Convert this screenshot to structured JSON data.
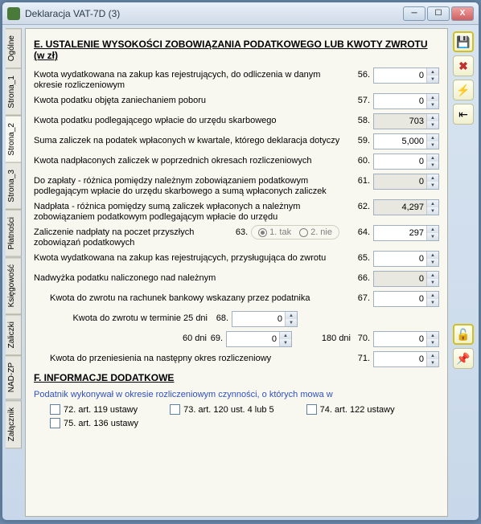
{
  "window": {
    "title": "Deklaracja VAT-7D (3)"
  },
  "tabs": [
    "Ogólne",
    "Strona_1",
    "Strona_2",
    "Strona_3",
    "Płatności",
    "Księgowość",
    "Zaliczki",
    "NAD-ZP",
    "Załącznik"
  ],
  "active_tab_index": 2,
  "section_e": {
    "header": "E. USTALENIE WYSOKOŚCI ZOBOWIĄZANIA PODATKOWEGO LUB KWOTY ZWROTU (w zł)",
    "rows": [
      {
        "label": "Kwota wydatkowana na zakup kas rejestrujących, do odliczenia w danym okresie rozliczeniowym",
        "num": "56.",
        "val": "0",
        "ro": false
      },
      {
        "label": "Kwota podatku objęta zaniechaniem poboru",
        "num": "57.",
        "val": "0",
        "ro": false
      },
      {
        "label": "Kwota podatku podlegającego wpłacie do urzędu skarbowego",
        "num": "58.",
        "val": "703",
        "ro": true
      },
      {
        "label": "Suma zaliczek na podatek wpłaconych w kwartale, którego deklaracja dotyczy",
        "num": "59.",
        "val": "5,000",
        "ro": false
      },
      {
        "label": "Kwota nadpłaconych zaliczek w poprzednich okresach rozliczeniowych",
        "num": "60.",
        "val": "0",
        "ro": false
      },
      {
        "label": "Do zapłaty - różnica pomiędzy należnym zobowiązaniem podatkowym podlegającym wpłacie do urzędu skarbowego a sumą wpłaconych zaliczek",
        "num": "61.",
        "val": "0",
        "ro": true
      },
      {
        "label": "Nadpłata - różnica pomiędzy sumą zaliczek wpłaconych a należnym zobowiązaniem podatkowym podlegającym wpłacie do urzędu",
        "num": "62.",
        "val": "4,297",
        "ro": true
      }
    ],
    "row63": {
      "label": "Zaliczenie nadpłaty na poczet przyszłych zobowiązań podatkowych",
      "num": "63.",
      "opt1": "1. tak",
      "opt2": "2. nie",
      "num64": "64.",
      "val64": "297"
    },
    "rows2": [
      {
        "label": "Kwota wydatkowana na zakup kas rejestrujących, przysługująca do zwrotu",
        "num": "65.",
        "val": "0",
        "ro": false
      },
      {
        "label": "Nadwyżka podatku naliczonego nad należnym",
        "num": "66.",
        "val": "0",
        "ro": true
      }
    ],
    "row67": {
      "label": "Kwota do zwrotu na rachunek bankowy wskazany przez podatnika",
      "num": "67.",
      "val": "0"
    },
    "row68": {
      "label": "Kwota do zwrotu w terminie 25 dni",
      "num": "68.",
      "val": "0"
    },
    "row69": {
      "label": "60 dni",
      "num": "69.",
      "val": "0",
      "label70": "180 dni",
      "num70": "70.",
      "val70": "0"
    },
    "row71": {
      "label": "Kwota do przeniesienia na następny okres rozliczeniowy",
      "num": "71.",
      "val": "0"
    }
  },
  "section_f": {
    "header": "F. INFORMACJE DODATKOWE",
    "link": "Podatnik wykonywał w okresie rozliczeniowym czynności, o których mowa w",
    "checks": [
      {
        "label": "72. art. 119 ustawy"
      },
      {
        "label": "73. art. 120 ust. 4 lub 5"
      },
      {
        "label": "74. art. 122 ustawy"
      },
      {
        "label": "75. art. 136 ustawy"
      }
    ]
  },
  "icons": {
    "min": "─",
    "max": "☐",
    "close": "X",
    "save": "💾",
    "cancel": "✖",
    "bolt": "⚡",
    "goto": "⇤",
    "lock": "🔓",
    "pin": "📌"
  }
}
